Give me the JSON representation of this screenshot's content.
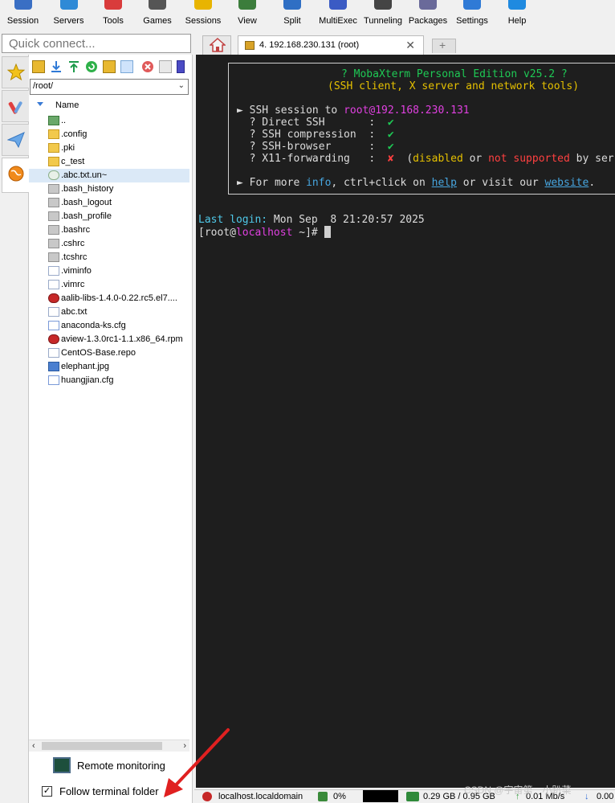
{
  "toolbar": {
    "items": [
      {
        "label": "Session",
        "icon": "session-icon",
        "color": "#3a6fc4"
      },
      {
        "label": "Servers",
        "icon": "servers-icon",
        "color": "#2f8ad6"
      },
      {
        "label": "Tools",
        "icon": "tools-icon",
        "color": "#d93b3b"
      },
      {
        "label": "Games",
        "icon": "games-icon",
        "color": "#555555"
      },
      {
        "label": "Sessions",
        "icon": "sessions-star-icon",
        "color": "#e8b400"
      },
      {
        "label": "View",
        "icon": "view-icon",
        "color": "#3c7d3c"
      },
      {
        "label": "Split",
        "icon": "split-icon",
        "color": "#2f6fc4"
      },
      {
        "label": "MultiExec",
        "icon": "multiexec-icon",
        "color": "#3b5bc4"
      },
      {
        "label": "Tunneling",
        "icon": "tunneling-icon",
        "color": "#444444"
      },
      {
        "label": "Packages",
        "icon": "packages-icon",
        "color": "#6a6a9a"
      },
      {
        "label": "Settings",
        "icon": "settings-gear-icon",
        "color": "#2f7ad6"
      },
      {
        "label": "Help",
        "icon": "help-icon",
        "color": "#1f8ae0"
      }
    ]
  },
  "quick_connect": {
    "placeholder": "Quick connect..."
  },
  "sftp": {
    "path": "/root/",
    "column_name": "Name",
    "files": [
      {
        "name": "..",
        "icon": "folder-up-icon",
        "selected": false
      },
      {
        "name": ".config",
        "icon": "folder-icon",
        "selected": false
      },
      {
        "name": ".pki",
        "icon": "folder-icon",
        "selected": false
      },
      {
        "name": "c_test",
        "icon": "folder-icon",
        "selected": false
      },
      {
        "name": ".abc.txt.un~",
        "icon": "hidden-file-icon",
        "selected": true
      },
      {
        "name": ".bash_history",
        "icon": "file-icon",
        "selected": false
      },
      {
        "name": ".bash_logout",
        "icon": "file-icon",
        "selected": false
      },
      {
        "name": ".bash_profile",
        "icon": "file-icon",
        "selected": false
      },
      {
        "name": ".bashrc",
        "icon": "file-icon",
        "selected": false
      },
      {
        "name": ".cshrc",
        "icon": "file-icon",
        "selected": false
      },
      {
        "name": ".tcshrc",
        "icon": "file-icon",
        "selected": false
      },
      {
        "name": ".viminfo",
        "icon": "text-file-icon",
        "selected": false
      },
      {
        "name": ".vimrc",
        "icon": "text-file-icon",
        "selected": false
      },
      {
        "name": "aalib-libs-1.4.0-0.22.rc5.el7....",
        "icon": "rpm-icon",
        "selected": false
      },
      {
        "name": "abc.txt",
        "icon": "text-file-icon",
        "selected": false
      },
      {
        "name": "anaconda-ks.cfg",
        "icon": "cfg-file-icon",
        "selected": false
      },
      {
        "name": "aview-1.3.0rc1-1.1.x86_64.rpm",
        "icon": "rpm-icon",
        "selected": false
      },
      {
        "name": "CentOS-Base.repo",
        "icon": "text-file-icon",
        "selected": false
      },
      {
        "name": "elephant.jpg",
        "icon": "image-file-icon",
        "selected": false
      },
      {
        "name": "huangjian.cfg",
        "icon": "cfg-file-icon",
        "selected": false
      }
    ],
    "remote_monitoring": "Remote monitoring",
    "follow_terminal_folder": "Follow terminal folder",
    "follow_checked": true
  },
  "tabs": {
    "session_title": "4. 192.168.230.131 (root)",
    "close_glyph": "✕",
    "new_tab_glyph": "+"
  },
  "terminal": {
    "banner_title": "? MobaXterm Personal Edition v25.2 ?",
    "banner_subtitle": "(SSH client, X server and network tools)",
    "ssh_prefix": "► SSH session to ",
    "ssh_target": "root@192.168.230.131",
    "checks": [
      {
        "label": "  ? Direct SSH       :  ",
        "mark": "✔",
        "ok": true
      },
      {
        "label": "  ? SSH compression  :  ",
        "mark": "✔",
        "ok": true
      },
      {
        "label": "  ? SSH-browser      :  ",
        "mark": "✔",
        "ok": true
      },
      {
        "label": "  ? X11-forwarding   :  ",
        "mark": "✘",
        "ok": false
      }
    ],
    "x11_open": "(",
    "x11_disabled": "disabled",
    "x11_or": " or ",
    "x11_not_supported": "not supported",
    "x11_by": " by ser",
    "info_prefix": "► For more ",
    "info_word": "info",
    "info_mid": ", ctrl+click on ",
    "help_word": "help",
    "info_mid2": " or visit our ",
    "website_word": "website",
    "info_end": ".",
    "last_login_label": "Last login:",
    "last_login_value": " Mon Sep  8 21:20:57 2025",
    "prompt_open": "[root@",
    "prompt_host": "localhost",
    "prompt_close": " ~]# "
  },
  "statusbar": {
    "host": "localhost.localdomain",
    "cpu": "0%",
    "memory": "0.29 GB / 0.95 GB",
    "net_up": "0.01 Mb/s",
    "net_down": "0.00"
  },
  "watermark": "CSDN @宇宙第一小趴菜"
}
